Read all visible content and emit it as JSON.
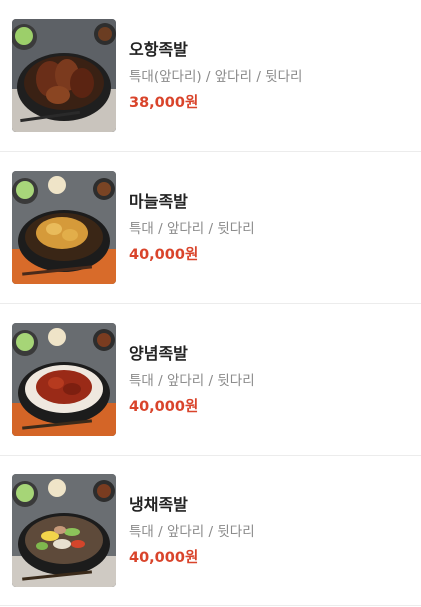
{
  "menu": {
    "items": [
      {
        "name": "오항족발",
        "options": "특대(앞다리) / 앞다리 / 뒷다리",
        "price": "38,000원",
        "image": "braised-pork-hock-photo"
      },
      {
        "name": "마늘족발",
        "options": "특대 / 앞다리 / 뒷다리",
        "price": "40,000원",
        "image": "garlic-pork-hock-photo"
      },
      {
        "name": "양념족발",
        "options": "특대 / 앞다리 / 뒷다리",
        "price": "40,000원",
        "image": "spicy-pork-hock-photo"
      },
      {
        "name": "냉채족발",
        "options": "특대 / 앞다리 / 뒷다리",
        "price": "40,000원",
        "image": "cold-salad-pork-hock-photo"
      }
    ]
  },
  "colors": {
    "price": "#d9442b",
    "name": "#222222",
    "options": "#8a8a8a",
    "divider": "#ececec"
  }
}
